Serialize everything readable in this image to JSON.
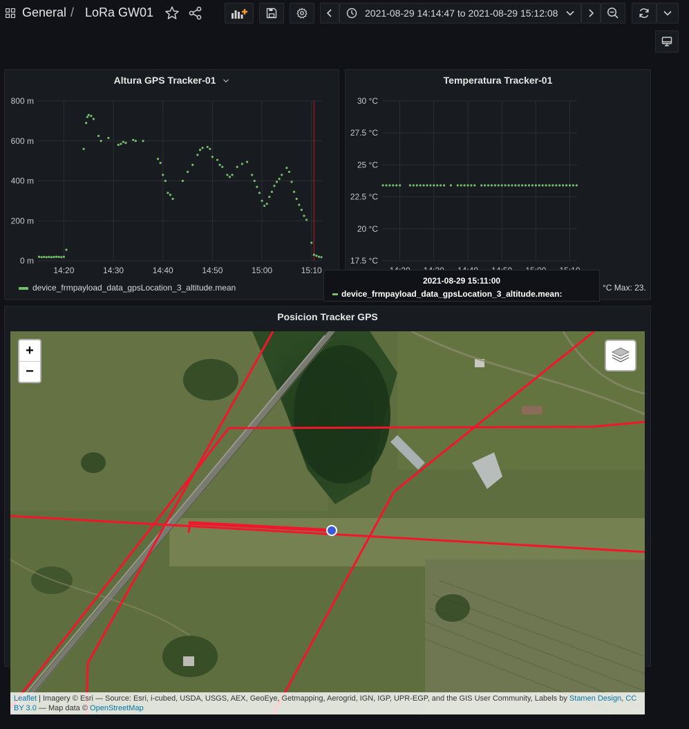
{
  "breadcrumb": {
    "folder": "General",
    "separator": "/",
    "dashboard": "LoRa GW01"
  },
  "time_range": {
    "label": "2021-08-29 14:14:47 to 2021-08-29 15:12:08"
  },
  "panels": {
    "altitude": {
      "title": "Altura GPS Tracker-01",
      "legend": "device_frmpayload_data_gpsLocation_3_altitude.mean",
      "y_ticks": [
        "800 m",
        "600 m",
        "400 m",
        "200 m",
        "0 m"
      ],
      "x_ticks": [
        "14:20",
        "14:30",
        "14:40",
        "14:50",
        "15:00",
        "15:10"
      ]
    },
    "temperature": {
      "title": "Temperatura Tracker-01",
      "y_ticks": [
        "30 °C",
        "27.5 °C",
        "25 °C",
        "22.5 °C",
        "20 °C",
        "17.5 °C"
      ],
      "x_ticks": [
        "14:20",
        "14:30",
        "14:40",
        "14:50",
        "15:00",
        "15:10"
      ],
      "legend_tail": "°C  Max: 23."
    },
    "map": {
      "title": "Posicion Tracker GPS"
    }
  },
  "tooltip": {
    "time": "2021-08-29 15:11:00",
    "series": "device_frmpayload_data_gpsLocation_3_altitude.mean:"
  },
  "map": {
    "zoom_in": "+",
    "zoom_out": "−",
    "attribution": {
      "leaflet": "Leaflet",
      "imagery": " | Imagery © Esri — Source: Esri, i-cubed, USDA, USGS, AEX, GeoEye, Getmapping, Aerogrid, IGN, IGP, UPR-EGP, and the GIS User Community, Labels by ",
      "stamen": "Stamen Design",
      "sep": ", ",
      "cc": "CC BY 3.0",
      "mapdata": " — Map data © ",
      "osm": "OpenStreetMap"
    }
  },
  "colors": {
    "series": "#73bf69",
    "track": "#f2162c",
    "marker": "#3b5bdb",
    "annotation": "#c4162a"
  },
  "chart_data": [
    {
      "type": "scatter",
      "title": "Altura GPS Tracker-01",
      "ylabel": "",
      "xlabel": "",
      "ylim": [
        0,
        800
      ],
      "unit": "m",
      "xlim": [
        "14:14:47",
        "15:12:08"
      ],
      "series": [
        {
          "name": "device_frmpayload_data_gpsLocation_3_altitude.mean",
          "x": [
            "14:15",
            "14:15:30",
            "14:16",
            "14:16:30",
            "14:17",
            "14:17:30",
            "14:18",
            "14:18:30",
            "14:19",
            "14:19:30",
            "14:20",
            "14:20:30",
            "14:24",
            "14:24:30",
            "14:24:45",
            "14:25",
            "14:25:30",
            "14:26",
            "14:27",
            "14:27:30",
            "14:29",
            "14:31",
            "14:31:30",
            "14:32",
            "14:32:30",
            "14:34",
            "14:34:30",
            "14:36",
            "14:39",
            "14:39:30",
            "14:40",
            "14:40:30",
            "14:41",
            "14:41:30",
            "14:42",
            "14:44",
            "14:45",
            "14:46",
            "14:47",
            "14:47:30",
            "14:48",
            "14:49",
            "14:49:30",
            "14:50",
            "14:51",
            "14:51:30",
            "14:52",
            "14:53",
            "14:53:30",
            "14:54",
            "14:55",
            "14:56",
            "14:57",
            "14:58",
            "14:58:30",
            "14:59",
            "14:59:30",
            "15:00",
            "15:00:30",
            "15:01",
            "15:01:30",
            "15:02",
            "15:02:30",
            "15:03",
            "15:03:30",
            "15:04",
            "15:05",
            "15:05:30",
            "15:06",
            "15:06:30",
            "15:07",
            "15:07:30",
            "15:08",
            "15:08:30",
            "15:09",
            "15:10",
            "15:10:30",
            "15:11",
            "15:11:30",
            "15:12"
          ],
          "values": [
            20,
            18,
            19,
            18,
            19,
            18,
            19,
            20,
            19,
            18,
            20,
            55,
            560,
            690,
            720,
            730,
            725,
            710,
            625,
            600,
            615,
            580,
            585,
            595,
            590,
            605,
            600,
            600,
            510,
            490,
            430,
            400,
            340,
            330,
            310,
            400,
            445,
            480,
            530,
            555,
            565,
            570,
            560,
            520,
            505,
            480,
            470,
            430,
            420,
            430,
            470,
            485,
            495,
            430,
            400,
            370,
            340,
            300,
            275,
            285,
            320,
            345,
            375,
            395,
            410,
            430,
            465,
            445,
            395,
            345,
            310,
            280,
            255,
            225,
            205,
            90,
            30,
            25,
            20,
            18
          ]
        }
      ]
    },
    {
      "type": "scatter",
      "title": "Temperatura Tracker-01",
      "ylim": [
        17.5,
        30
      ],
      "unit": "°C",
      "xlim": [
        "14:14:47",
        "15:12:08"
      ],
      "series": [
        {
          "name": "device_frmpayload_data_gpsLocation_3_altitude.mean",
          "x": [
            "14:15",
            "14:16",
            "14:17",
            "14:18",
            "14:19",
            "14:20",
            "14:23",
            "14:24",
            "14:25",
            "14:26",
            "14:27",
            "14:28",
            "14:29",
            "14:30",
            "14:31",
            "14:32",
            "14:33",
            "14:35",
            "14:37",
            "14:38",
            "14:39",
            "14:40",
            "14:41",
            "14:42",
            "14:44",
            "14:45",
            "14:46",
            "14:47",
            "14:48",
            "14:49",
            "14:50",
            "14:51",
            "14:52",
            "14:53",
            "14:54",
            "14:55",
            "14:56",
            "14:57",
            "14:58",
            "14:59",
            "15:00",
            "15:01",
            "15:02",
            "15:03",
            "15:04",
            "15:05",
            "15:06",
            "15:07",
            "15:08",
            "15:09",
            "15:10",
            "15:11",
            "15:12"
          ],
          "values": [
            23.4,
            23.4,
            23.4,
            23.4,
            23.4,
            23.4,
            23.4,
            23.4,
            23.4,
            23.4,
            23.4,
            23.4,
            23.4,
            23.4,
            23.4,
            23.4,
            23.4,
            23.4,
            23.4,
            23.4,
            23.4,
            23.4,
            23.4,
            23.4,
            23.4,
            23.4,
            23.4,
            23.4,
            23.4,
            23.4,
            23.4,
            23.4,
            23.4,
            23.4,
            23.4,
            23.4,
            23.4,
            23.4,
            23.4,
            23.4,
            23.4,
            23.4,
            23.4,
            23.4,
            23.4,
            23.4,
            23.4,
            23.4,
            23.4,
            23.4,
            23.4,
            23.4,
            23.4
          ]
        }
      ]
    }
  ]
}
